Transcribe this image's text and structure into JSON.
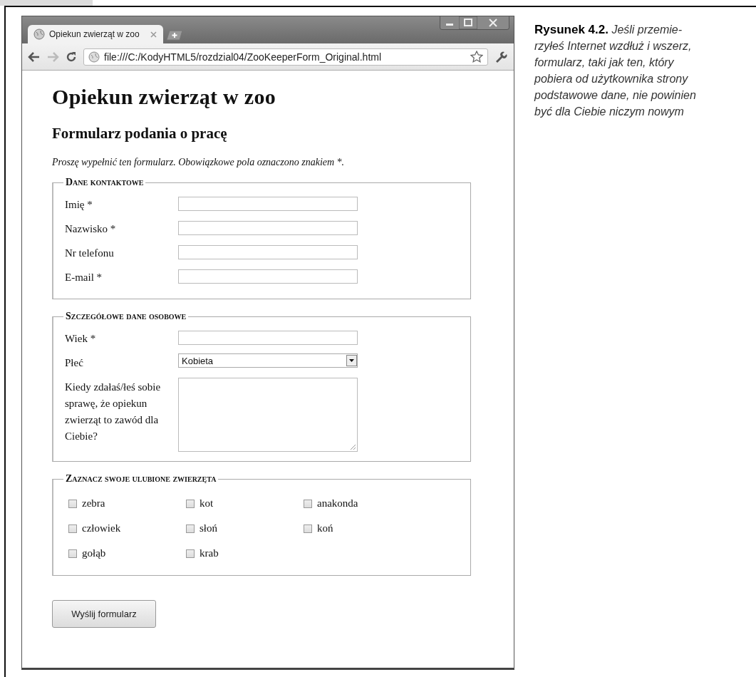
{
  "browser": {
    "tabs": [
      {
        "title": "Opiekun zwierząt w zoo",
        "selected": true
      }
    ],
    "address": "file:///C:/KodyHTML5/rozdzial04/ZooKeeperForm_Original.html"
  },
  "page": {
    "title": "Opiekun zwierząt w zoo",
    "subtitle": "Formularz podania o pracę",
    "intro": "Proszę wypełnić ten formularz. Obowiązkowe pola oznaczono znakiem *.",
    "sections": [
      {
        "legend": "Dane kontaktowe",
        "kind": "fields",
        "fields": [
          {
            "kind": "text",
            "label": "Imię *"
          },
          {
            "kind": "text",
            "label": "Nazwisko *"
          },
          {
            "kind": "text",
            "label": "Nr telefonu"
          },
          {
            "kind": "text",
            "label": "E-mail *"
          }
        ]
      },
      {
        "legend": "Szczegółowe dane osobowe",
        "kind": "fields",
        "fields": [
          {
            "kind": "text",
            "label": "Wiek *"
          },
          {
            "kind": "select",
            "label": "Płeć",
            "value": "Kobieta"
          },
          {
            "kind": "textarea",
            "label": "Kiedy zdałaś/łeś sobie sprawę, że opiekun zwierząt to zawód dla Ciebie?"
          }
        ]
      },
      {
        "legend": "Zaznacz swoje ulubione zwierzęta",
        "kind": "checkboxes",
        "options": [
          {
            "label": "zebra",
            "checked": false
          },
          {
            "label": "kot",
            "checked": false
          },
          {
            "label": "anakonda",
            "checked": false
          },
          {
            "label": "człowiek",
            "checked": false
          },
          {
            "label": "słoń",
            "checked": false
          },
          {
            "label": "koń",
            "checked": false
          },
          {
            "label": "gołąb",
            "checked": false
          },
          {
            "label": "krab",
            "checked": false
          }
        ]
      }
    ],
    "submit": "Wyślij formularz"
  },
  "caption": {
    "lines": [
      "**Rysunek 4.2.** Jeśli przemie-",
      "rzyłeś Internet wzdłuż i wszerz,",
      "formularz, taki jak ten, który",
      "pobiera od użytkownika strony",
      "podstawowe dane, nie powinien",
      "być dla Ciebie niczym nowym"
    ]
  }
}
